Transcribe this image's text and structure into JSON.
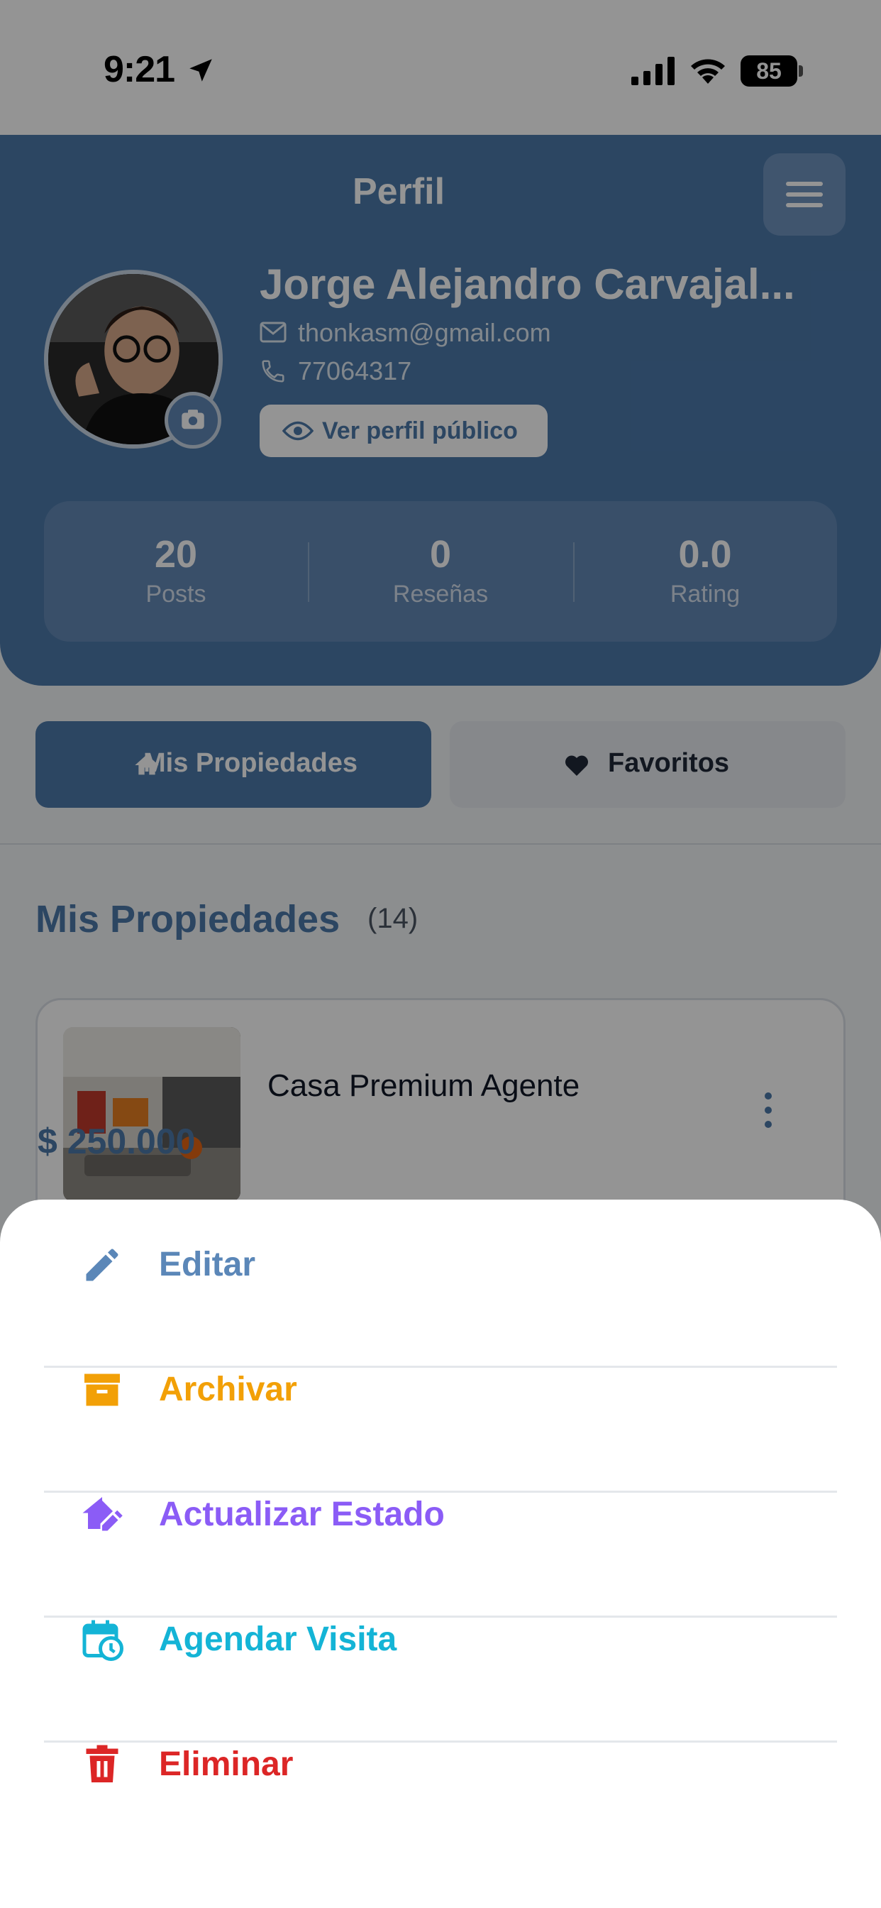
{
  "status_bar": {
    "time": "9:21",
    "battery": "85"
  },
  "header": {
    "title": "Perfil"
  },
  "profile": {
    "name": "Jorge Alejandro Carvajal...",
    "email": "thonkasm@gmail.com",
    "phone": "77064317",
    "public_profile_label": "Ver perfil público"
  },
  "stats": [
    {
      "value": "20",
      "label": "Posts"
    },
    {
      "value": "0",
      "label": "Reseñas"
    },
    {
      "value": "0.0",
      "label": "Rating"
    }
  ],
  "tabs": {
    "mine": "Mis Propiedades",
    "favorites": "Favoritos"
  },
  "section": {
    "title": "Mis Propiedades",
    "count": "(14)"
  },
  "property": {
    "name": "Casa Premium Agente",
    "price": "$ 250.000"
  },
  "actions": [
    {
      "label": "Editar",
      "icon": "pencil-icon",
      "color": "#5b87b8"
    },
    {
      "label": "Archivar",
      "icon": "archive-icon",
      "color": "#f2a007"
    },
    {
      "label": "Actualizar Estado",
      "icon": "home-edit-icon",
      "color": "#8b5cf6"
    },
    {
      "label": "Agendar Visita",
      "icon": "calendar-clock-icon",
      "color": "#14b4d6"
    },
    {
      "label": "Eliminar",
      "icon": "trash-icon",
      "color": "#dc2626"
    }
  ],
  "colors": {
    "primary": "#4c79aa",
    "overlay": "rgba(0,0,0,0.42)"
  }
}
